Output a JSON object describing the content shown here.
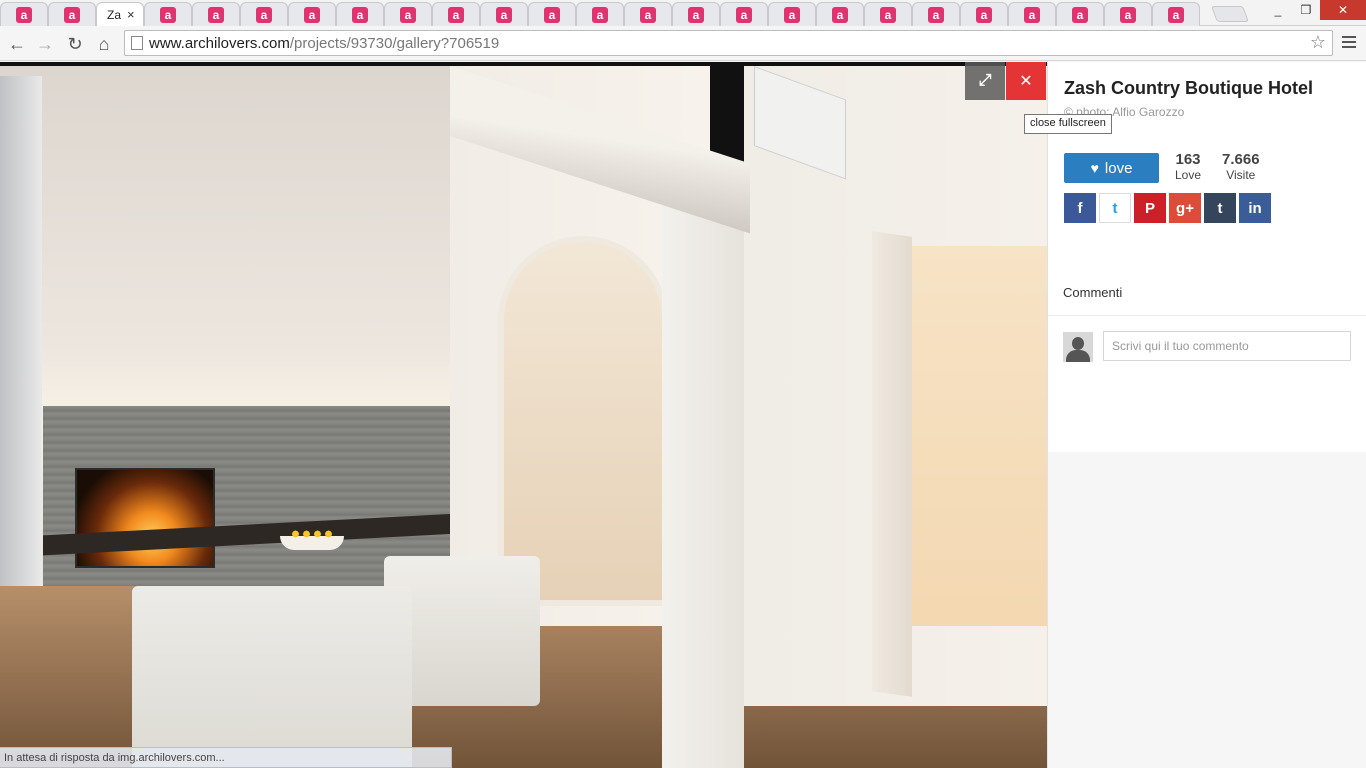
{
  "browser": {
    "tabs": {
      "favicon_letter": "a",
      "active_tab_title": "Za",
      "active_tab_close": "×",
      "count_before_active": 2,
      "count_after_active": 22
    },
    "url_host": "www.archilovers.com",
    "url_path": "/projects/93730/gallery?706519",
    "window_controls": {
      "restore": "❐",
      "close": "✕"
    }
  },
  "viewer": {
    "expand_icon": "⤢",
    "close_icon": "✕",
    "tooltip": "close fullscreen",
    "status_text": "In attesa di risposta da img.archilovers.com..."
  },
  "panel": {
    "title": "Zash Country Boutique Hotel",
    "credit": "© photo: Alfio Garozzo",
    "love_label": "love",
    "love_count": "163",
    "love_count_label": "Love",
    "visits_count": "7.666",
    "visits_label": "Visite",
    "social": [
      {
        "label": "f",
        "color": "#3b5998",
        "name": "facebook"
      },
      {
        "label": "t",
        "color": "#ffffff",
        "name": "twitter"
      },
      {
        "label": "P",
        "color": "#cb2027",
        "name": "pinterest"
      },
      {
        "label": "g+",
        "color": "#dd4b39",
        "name": "google-plus"
      },
      {
        "label": "t",
        "color": "#35465c",
        "name": "tumblr"
      },
      {
        "label": "in",
        "color": "#3a5d99",
        "name": "linkedin"
      }
    ],
    "comments_label": "Commenti",
    "comment_placeholder": "Scrivi qui il tuo commento"
  },
  "colors": {
    "accent_blue": "#2b7fc1",
    "close_red": "#e53435",
    "favicon_pink": "#e0336f"
  }
}
